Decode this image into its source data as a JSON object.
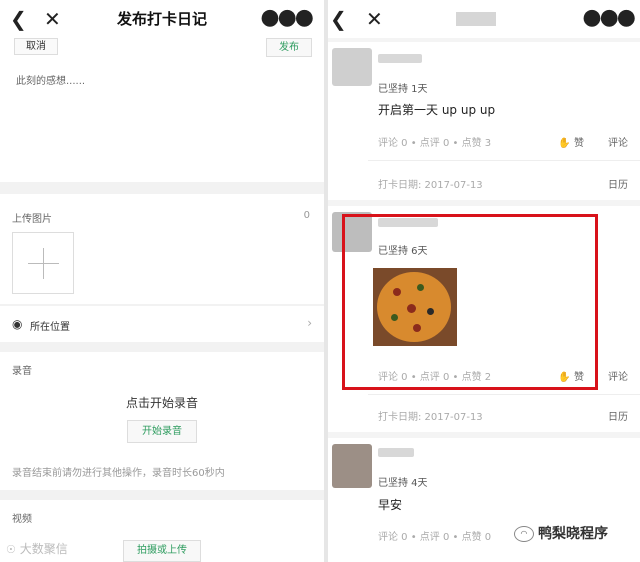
{
  "left": {
    "title": "发布打卡日记",
    "cancel": "取消",
    "publish": "发布",
    "placeholder": "此刻的感想......",
    "upload_label": "上传图片",
    "upload_count": "0",
    "location": "所在位置",
    "audio_label": "录音",
    "audio_hint": "点击开始录音",
    "audio_button": "开始录音",
    "audio_note": "录音结束前请勿进行其他操作，录音时长60秒内",
    "video_label": "视频",
    "video_button": "拍摄或上传"
  },
  "right": {
    "posts": [
      {
        "streak": "已坚持 1天",
        "content": "开启第一天 up up up",
        "stats": "评论 0 • 点评 0 • 点赞 3",
        "like": "赞",
        "comment": "评论",
        "date": "打卡日期: 2017-07-13",
        "calendar": "日历"
      },
      {
        "streak": "已坚持 6天",
        "stats": "评论 0 • 点评 0 • 点赞 2",
        "like": "赞",
        "comment": "评论",
        "date": "打卡日期: 2017-07-13",
        "calendar": "日历"
      },
      {
        "streak": "已坚持 4天",
        "content": "早安",
        "stats": "评论 0 • 点评 0 • 点赞 0"
      }
    ]
  },
  "watermarks": {
    "left": "大数聚信",
    "right": "鸭梨晓程序"
  },
  "colors": {
    "accent_green": "#2e9c5f",
    "highlight_red": "#d8121a"
  }
}
